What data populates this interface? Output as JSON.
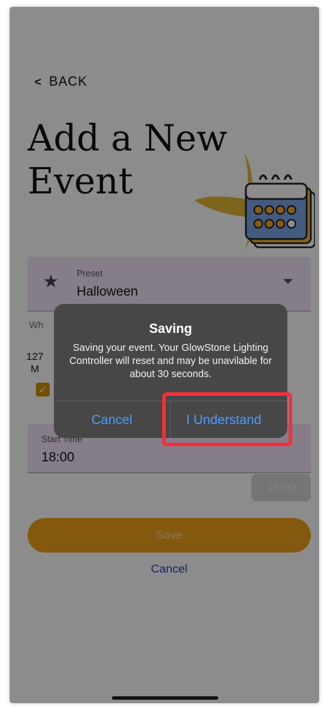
{
  "nav": {
    "back_label": "BACK"
  },
  "page": {
    "title": "Add a New Event"
  },
  "preset": {
    "label": "Preset",
    "value": "Halloween",
    "icon": "star-icon"
  },
  "behind": {
    "wh_text": "Wh",
    "num_text": "127",
    "m_text": "M"
  },
  "start_time": {
    "label": "Start Time",
    "value": "18:00",
    "chip": "18:00"
  },
  "actions": {
    "save_label": "Save",
    "cancel_label": "Cancel"
  },
  "alert": {
    "title": "Saving",
    "message": "Saving your event. Your GlowStone Lighting Controller will reset and may be unavilable for about 30 seconds.",
    "cancel_label": "Cancel",
    "confirm_label": "I Understand"
  },
  "colors": {
    "accent": "#f0a01c",
    "link": "#2241b8",
    "alert_button": "#4a9eff",
    "highlight": "#ff2b3a"
  }
}
